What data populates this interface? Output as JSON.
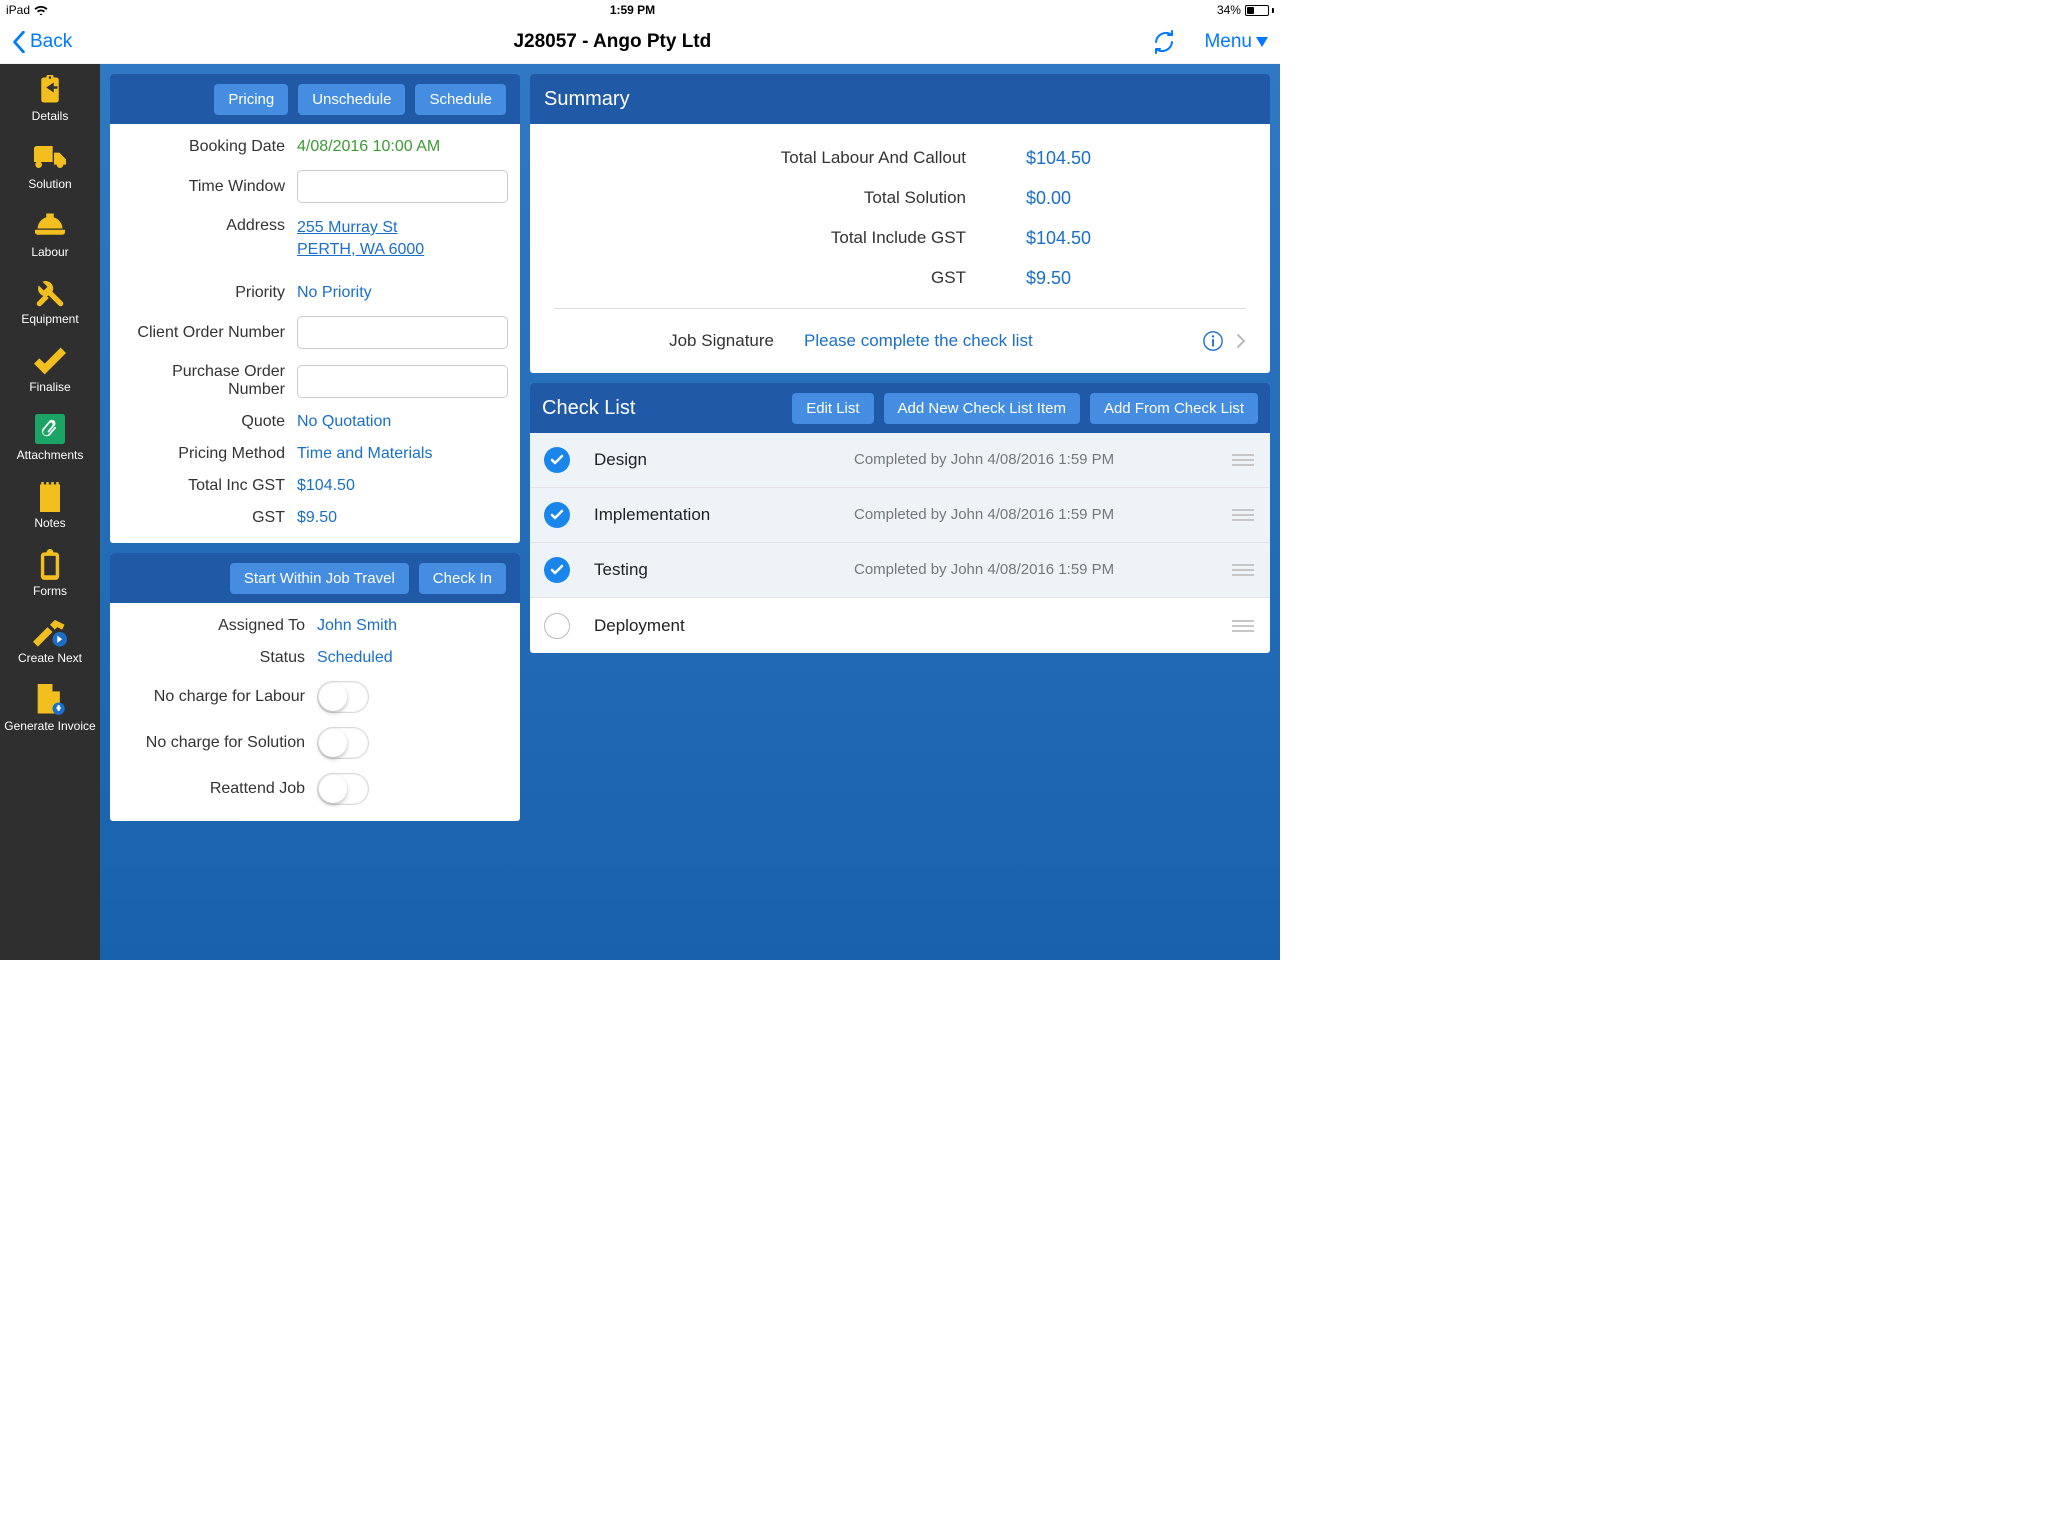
{
  "status_bar": {
    "device": "iPad",
    "time": "1:59 PM",
    "battery_pct": "34%"
  },
  "nav": {
    "back": "Back",
    "title": "J28057 - Ango Pty Ltd",
    "menu": "Menu"
  },
  "sidebar": {
    "items": [
      {
        "label": "Details"
      },
      {
        "label": "Solution"
      },
      {
        "label": "Labour"
      },
      {
        "label": "Equipment"
      },
      {
        "label": "Finalise"
      },
      {
        "label": "Attachments"
      },
      {
        "label": "Notes"
      },
      {
        "label": "Forms"
      },
      {
        "label": "Create Next"
      },
      {
        "label": "Generate Invoice"
      }
    ]
  },
  "top_actions": {
    "pricing": "Pricing",
    "unschedule": "Unschedule",
    "schedule": "Schedule"
  },
  "details": {
    "booking_date_label": "Booking Date",
    "booking_date": "4/08/2016 10:00 AM",
    "time_window_label": "Time Window",
    "time_window": "",
    "address_label": "Address",
    "address_line1": "255 Murray St",
    "address_line2": "PERTH, WA 6000",
    "priority_label": "Priority",
    "priority": "No Priority",
    "client_order_label": "Client Order Number",
    "client_order": "",
    "purchase_order_label": "Purchase Order Number",
    "purchase_order": "",
    "quote_label": "Quote",
    "quote": "No Quotation",
    "pricing_method_label": "Pricing Method",
    "pricing_method": "Time and Materials",
    "total_inc_gst_label": "Total Inc GST",
    "total_inc_gst": "$104.50",
    "gst_label": "GST",
    "gst": "$9.50"
  },
  "assign_actions": {
    "start_travel": "Start Within Job Travel",
    "check_in": "Check In"
  },
  "assign": {
    "assigned_to_label": "Assigned To",
    "assigned_to": "John Smith",
    "status_label": "Status",
    "status": "Scheduled",
    "no_charge_labour_label": "No charge for Labour",
    "no_charge_solution_label": "No charge for Solution",
    "reattend_label": "Reattend Job"
  },
  "summary": {
    "title": "Summary",
    "rows": [
      {
        "label": "Total Labour And Callout",
        "value": "$104.50"
      },
      {
        "label": "Total Solution",
        "value": "$0.00"
      },
      {
        "label": "Total Include GST",
        "value": "$104.50"
      },
      {
        "label": "GST",
        "value": "$9.50"
      }
    ],
    "sig_label": "Job Signature",
    "sig_value": "Please complete the check list"
  },
  "checklist": {
    "title": "Check List",
    "edit": "Edit List",
    "add": "Add New Check List Item",
    "addfrom": "Add From Check List",
    "items": [
      {
        "name": "Design",
        "done": true,
        "meta": "Completed by John 4/08/2016 1:59 PM"
      },
      {
        "name": "Implementation",
        "done": true,
        "meta": "Completed by John 4/08/2016 1:59 PM"
      },
      {
        "name": "Testing",
        "done": true,
        "meta": "Completed by John 4/08/2016 1:59 PM"
      },
      {
        "name": "Deployment",
        "done": false,
        "meta": ""
      }
    ]
  }
}
